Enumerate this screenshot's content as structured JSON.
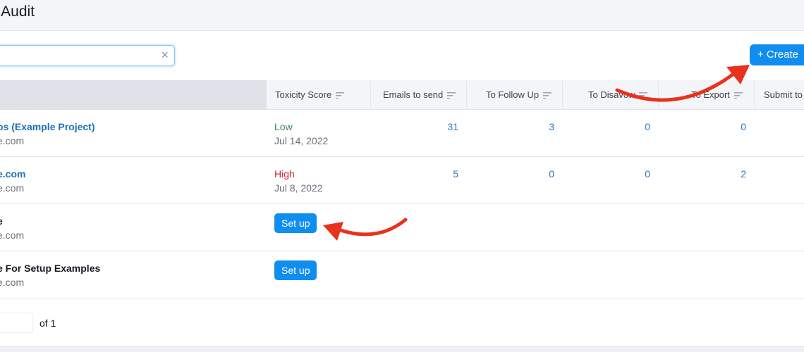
{
  "header": {
    "title": "k Audit"
  },
  "search": {
    "clear_icon": "×"
  },
  "toolbar": {
    "create_label": "+  Create"
  },
  "table": {
    "columns": [
      "Toxicity Score",
      "Emails to send",
      "To Follow Up",
      "To Disavow",
      "To Export",
      "Submit to"
    ],
    "rows": [
      {
        "name": "os (Example Project)",
        "domain": "e.com",
        "toxicity": "Low",
        "toxicity_color": "#2e8b57",
        "date": "Jul 14, 2022",
        "emails": "31",
        "follow": "3",
        "disavow": "0",
        "export": "0"
      },
      {
        "name": "e.com",
        "domain": "e.com",
        "toxicity": "High",
        "toxicity_color": "#d1283a",
        "date": "Jul 8, 2022",
        "emails": "5",
        "follow": "0",
        "disavow": "0",
        "export": "2"
      },
      {
        "name": "e",
        "domain": "e.com",
        "setup": "Set up"
      },
      {
        "name": "e For Setup Examples",
        "domain": "e.com",
        "setup": "Set up"
      }
    ]
  },
  "pagination": {
    "of_label": "of 1"
  },
  "annotations": {
    "arrow_color": "#e8321e"
  }
}
